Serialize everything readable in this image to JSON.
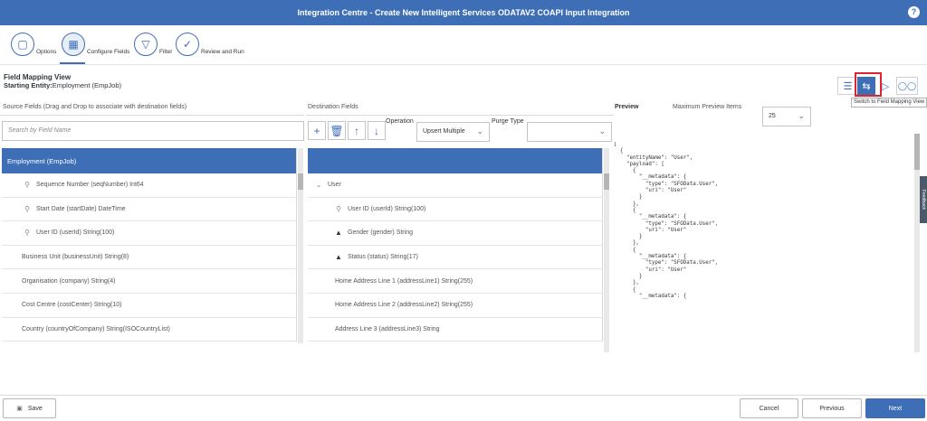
{
  "header": {
    "title": "Integration Centre - Create New Intelligent Services ODATAV2 COAPI Input Integration",
    "help": "?"
  },
  "steps": [
    {
      "label": "Options",
      "icon": "document-icon"
    },
    {
      "label": "Configure Fields",
      "icon": "grid-icon"
    },
    {
      "label": "Filter",
      "icon": "filter-icon"
    },
    {
      "label": "Review and Run",
      "icon": "checkmark-icon"
    }
  ],
  "view": {
    "title": "Field Mapping View",
    "entity_label": "Starting Entity:",
    "entity_value": "Employment (EmpJob)"
  },
  "tooltip": "Switch to Field Mapping View",
  "source": {
    "header": "Source Fields (Drag and Drop to associate with destination fields)",
    "search_placeholder": "Search by Field Name",
    "group": "Employment (EmpJob)",
    "rows": [
      {
        "text": "Sequence Number (seqNumber) Int64",
        "key": true
      },
      {
        "text": "Start Date (startDate) DateTime",
        "key": true
      },
      {
        "text": "User ID (userId) String(100)",
        "key": true
      },
      {
        "text": "Business Unit (businessUnit) String(8)",
        "key": false
      },
      {
        "text": "Organisation (company) String(4)",
        "key": false
      },
      {
        "text": "Cost Centre (costCenter) String(10)",
        "key": false
      },
      {
        "text": "Country (countryOfCompany) String(ISOCountryList)",
        "key": false
      }
    ]
  },
  "destination": {
    "header": "Destination Fields",
    "operation_label": "Operation",
    "operation_value": "Upsert Multiple",
    "purge_label": "Purge Type",
    "purge_value": "",
    "group": "User",
    "rows": [
      {
        "text": "User ID (userId) String(100)",
        "icon": "key"
      },
      {
        "text": "Gender (gender) String",
        "icon": "warning"
      },
      {
        "text": "Status (status) String(17)",
        "icon": "warning"
      },
      {
        "text": "Home Address Line 1 (addressLine1) String(255)",
        "icon": ""
      },
      {
        "text": "Home Address Line 2 (addressLine2) String(255)",
        "icon": ""
      },
      {
        "text": "Address Line 3 (addressLine3) String",
        "icon": ""
      }
    ]
  },
  "preview": {
    "label": "Preview",
    "max_label": "Maximum Preview Items",
    "max_value": "25",
    "code": "[\n  {\n    \"entityName\": \"User\",\n    \"payload\": [\n      {\n        \"__metadata\": {\n          \"type\": \"SFOData.User\",\n          \"uri\": \"User\"\n        }\n      },\n      {\n        \"__metadata\": {\n          \"type\": \"SFOData.User\",\n          \"uri\": \"User\"\n        }\n      },\n      {\n        \"__metadata\": {\n          \"type\": \"SFOData.User\",\n          \"uri\": \"User\"\n        }\n      },\n      {\n        \"__metadata\": {"
  },
  "side_tab": "Feedback",
  "footer": {
    "save": "Save",
    "cancel": "Cancel",
    "previous": "Previous",
    "next": "Next"
  }
}
